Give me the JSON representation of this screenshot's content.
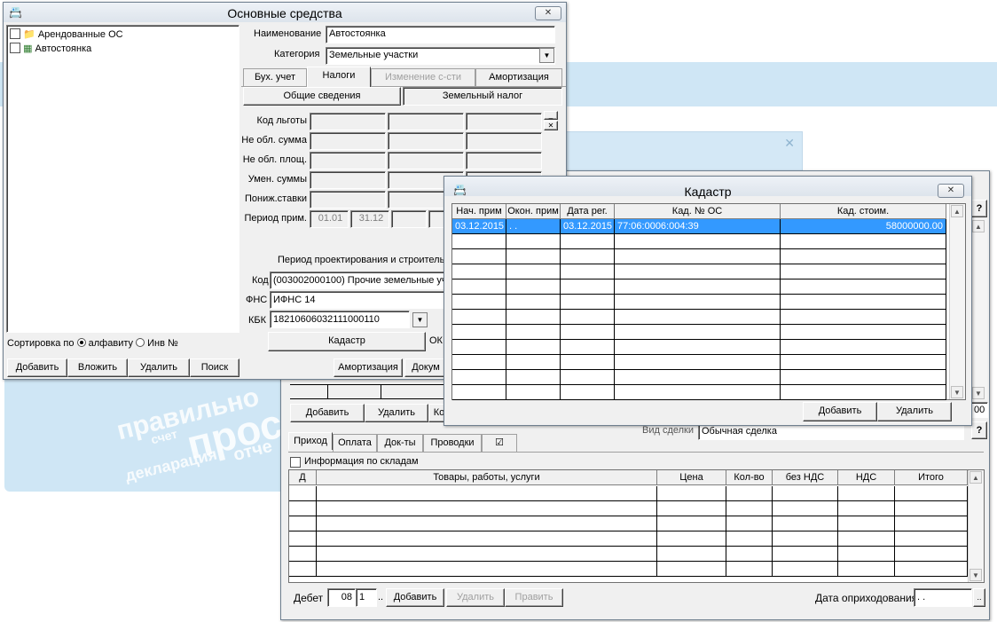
{
  "background": {
    "watermark": [
      "правильно",
      "счет",
      "прос",
      "декларация",
      "отче"
    ]
  },
  "os_window": {
    "title": "Основные средства",
    "close_icon": "✕",
    "tree": [
      {
        "label": "Арендованные ОС",
        "icon": "folder-icon"
      },
      {
        "label": "Автостоянка",
        "icon": "table-icon"
      }
    ],
    "sort_label": "Сортировка по",
    "sort_options": [
      "алфавиту",
      "Инв №"
    ],
    "sort_selected": "алфавиту",
    "bottom_buttons": [
      "Добавить",
      "Вложить",
      "Удалить",
      "Поиск"
    ],
    "name_label": "Наименование",
    "name_value": "Автостоянка",
    "category_label": "Категория",
    "category_value": "Земельные участки",
    "tabs": [
      "Бух. учет",
      "Налоги",
      "Изменение с-сти",
      "Амортизация"
    ],
    "active_tab": "Налоги",
    "subtabs": [
      "Общие сведения",
      "Земельный налог"
    ],
    "active_subtab": "Земельный налог",
    "row_labels": [
      "Код льготы",
      "Не обл. сумма",
      "Не обл. площ.",
      "Умен. суммы",
      "Пониж.ставки",
      "Период прим."
    ],
    "period_values": [
      "01.01",
      "31.12"
    ],
    "period_section_label": "Период проектирования и строитель",
    "kod_label": "Код",
    "kod_value": "(003002000100) Прочие земельные уч",
    "fns_label": "ФНС",
    "fns_value": "ИФНС 14",
    "kbk_label": "КБК",
    "kbk_value": "18210606032111000110",
    "kadastr_button": "Кадастр",
    "ok_label": "ОК",
    "amort_button": "Амортизация",
    "docs_button": "Докум"
  },
  "bg_window": {
    "buttons": [
      "Добавить",
      "Удалить",
      "Ко"
    ],
    "deal_label": "Вид сделки",
    "deal_value": "Обычная сделка",
    "question": "?",
    "field_value": "00",
    "tabs": [
      "Приход",
      "Оплата",
      "Док-ты",
      "Проводки",
      "☑"
    ],
    "active_tab": "Приход",
    "warehouse_label": "Информация по складам",
    "columns": [
      "Д",
      "Товары, работы, услуги",
      "Цена",
      "Кол-во",
      "без НДС",
      "НДС",
      "Итого"
    ],
    "debet_label": "Дебет",
    "debet_account": "08",
    "debet_sub": "1",
    "dots": "..",
    "actions": [
      "Добавить",
      "Удалить",
      "Править"
    ],
    "date_label": "Дата оприходования",
    "date_value": " .  ."
  },
  "kadastr_window": {
    "title": "Кадастр",
    "close_icon": "✕",
    "columns": [
      "Нач. прим",
      "Окон. прим",
      "Дата рег.",
      "Кад. № ОС",
      "Кад. стоим."
    ],
    "rows": [
      {
        "start": "03.12.2015",
        "end": " .  .",
        "reg_date": "03.12.2015",
        "cad_no": "77:06:0006:004:39",
        "cad_cost": "58000000.00"
      }
    ],
    "buttons": [
      "Добавить",
      "Удалить"
    ]
  }
}
